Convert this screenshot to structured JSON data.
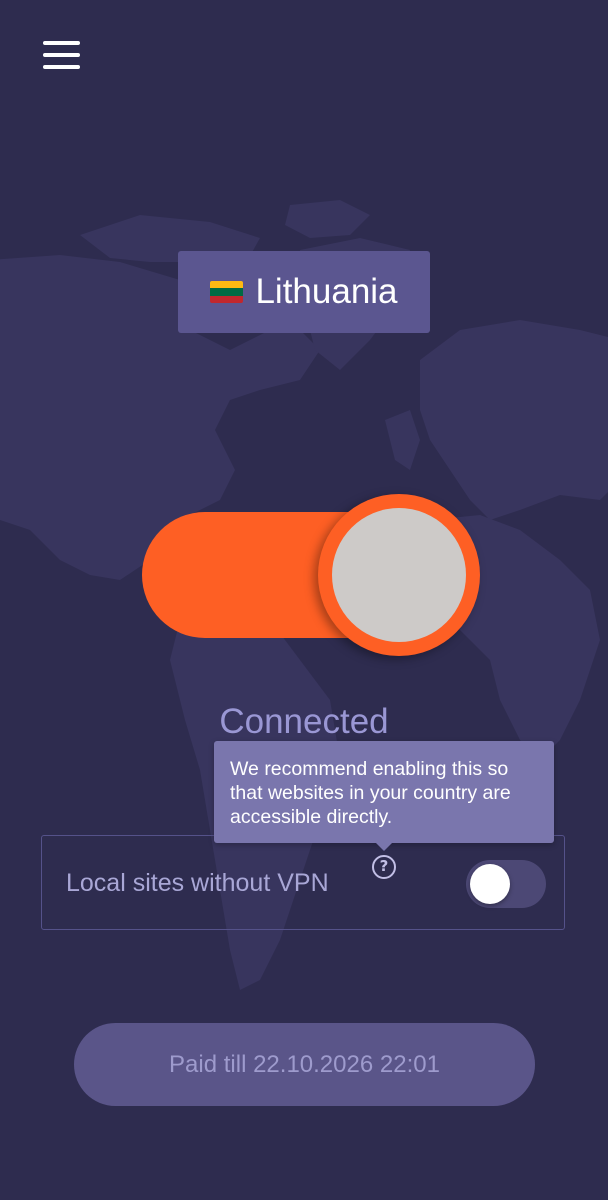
{
  "header": {
    "menu_icon": "hamburger-menu-icon"
  },
  "location": {
    "country": "Lithuania",
    "flag_icon": "lithuania-flag-icon",
    "flag_colors": [
      "#fdb913",
      "#006a44",
      "#c1272d"
    ]
  },
  "connection": {
    "status": "Connected",
    "connected": true,
    "accent_color": "#fe5f24"
  },
  "tooltip": {
    "text": "We recommend enabling this so that websites in your country are accessible directly."
  },
  "local_sites": {
    "label": "Local sites without VPN",
    "help_icon": "question-mark-icon",
    "help_glyph": "?",
    "enabled": false
  },
  "subscription": {
    "text": "Paid till 22.10.2026 22:01"
  }
}
